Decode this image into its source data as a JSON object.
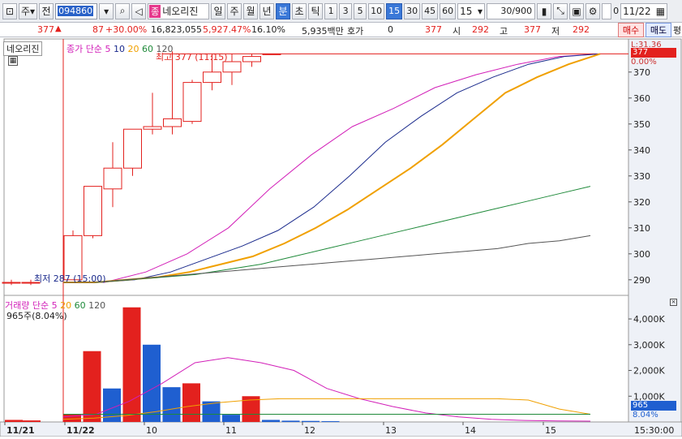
{
  "toolbar": {
    "market_label": "주",
    "all_label": "전",
    "stock_code": "094860",
    "stock_type_tag": "종",
    "stock_name": "네오리진",
    "periods": [
      "일",
      "주",
      "월",
      "년",
      "분",
      "초",
      "틱"
    ],
    "active_period": "분",
    "intervals": [
      "1",
      "3",
      "5",
      "10",
      "15",
      "30",
      "45",
      "60"
    ],
    "active_interval": "15",
    "interval_select": "15",
    "count": "30/900",
    "check_label": "0",
    "date": "11/22"
  },
  "quote": {
    "price": "377",
    "change": "87",
    "change_pct": "+30.00%",
    "volume": "16,823,055",
    "volume_pct": "5,927.47%",
    "turnover_pct": "16.10%",
    "amount": "5,935백만",
    "hoga_label": "호가",
    "hoga_value": "0",
    "hoga_price": "377",
    "open_label": "시",
    "open": "292",
    "high_label": "고",
    "high": "377",
    "low_label": "저",
    "low": "292",
    "buy_label": "매수",
    "sell_label": "매도",
    "avg_label": "평"
  },
  "price_panel": {
    "name_box": "네오리진",
    "ma_title": "종가 단순",
    "ma_periods": [
      "5",
      "10",
      "20",
      "60",
      "120"
    ],
    "high_marker": "최고 377 (11:15)",
    "low_marker": "최저 287 (15:00)",
    "corner_info": "L:31.36",
    "current_price_tag": "377",
    "pct_tag": "0.00%"
  },
  "volume_panel": {
    "title": "거래량 단순",
    "ma_periods": [
      "5",
      "20",
      "60",
      "120"
    ],
    "current": "965주(8.04%)",
    "current_tag": "965",
    "pct_tag": "8.04%"
  },
  "colors": {
    "up": "#e3211e",
    "down": "#1f5fd0",
    "ma5": "#d21fb8",
    "ma10": "#1a2a8c",
    "ma20": "#f0a000",
    "ma60": "#1f8a3a",
    "ma120": "#555555"
  },
  "chart_data": [
    {
      "type": "candlestick",
      "title": "네오리진 15분",
      "y_ticks": [
        290,
        300,
        310,
        320,
        330,
        340,
        350,
        360,
        370
      ],
      "ylim": [
        284,
        379
      ],
      "x_ticks": [
        "11/21",
        "11/22",
        "10",
        "11",
        "12",
        "13",
        "14",
        "15"
      ],
      "candles": [
        {
          "o": 289,
          "h": 290,
          "l": 288,
          "c": 289
        },
        {
          "o": 289,
          "h": 290,
          "l": 288,
          "c": 289
        },
        {
          "o": 290,
          "h": 309,
          "l": 290,
          "c": 307
        },
        {
          "o": 307,
          "h": 314,
          "l": 306,
          "c": 326
        },
        {
          "o": 325,
          "h": 343,
          "l": 318,
          "c": 333
        },
        {
          "o": 333,
          "h": 340,
          "l": 330,
          "c": 348
        },
        {
          "o": 348,
          "h": 362,
          "l": 346,
          "c": 349
        },
        {
          "o": 349,
          "h": 378,
          "l": 346,
          "c": 352
        },
        {
          "o": 351,
          "h": 367,
          "l": 350,
          "c": 366
        },
        {
          "o": 366,
          "h": 377,
          "l": 363,
          "c": 370
        },
        {
          "o": 370,
          "h": 377,
          "l": 365,
          "c": 374
        },
        {
          "o": 374,
          "h": 377,
          "l": 372,
          "c": 376
        },
        {
          "o": 377,
          "h": 377,
          "l": 377,
          "c": 377
        }
      ],
      "series": [
        {
          "name": "5",
          "values": [
            289,
            289,
            293,
            300,
            310,
            325,
            338,
            349,
            356,
            364,
            369,
            373,
            376,
            377
          ]
        },
        {
          "name": "10",
          "values": [
            289,
            289,
            290,
            293,
            298,
            303,
            309,
            318,
            330,
            343,
            353,
            362,
            368,
            373,
            376,
            377
          ]
        },
        {
          "name": "20",
          "values": [
            289,
            289,
            290,
            291,
            293,
            296,
            299,
            304,
            310,
            317,
            325,
            333,
            342,
            352,
            362,
            368,
            373,
            377
          ]
        },
        {
          "name": "60",
          "values": [
            289,
            289,
            290,
            291,
            292,
            294,
            296,
            299,
            302,
            305,
            308,
            311,
            314,
            317,
            320,
            323,
            326
          ]
        },
        {
          "name": "120",
          "values": [
            289,
            289,
            290,
            291,
            292,
            293,
            294,
            295,
            296,
            297,
            298,
            299,
            300,
            301,
            302,
            304,
            305,
            307
          ]
        }
      ]
    },
    {
      "type": "bar",
      "title": "거래량",
      "y_ticks": [
        "1,000K",
        "2,000K",
        "3,000K",
        "4,000K"
      ],
      "ylim": [
        0,
        4600
      ],
      "values": [
        80,
        60,
        300,
        2750,
        1300,
        4450,
        3000,
        1350,
        1500,
        800,
        280,
        1000,
        80,
        50,
        40,
        30
      ],
      "directions": [
        "up",
        "up",
        "up",
        "up",
        "down",
        "up",
        "down",
        "down",
        "up",
        "down",
        "down",
        "up",
        "down",
        "down",
        "down",
        "down"
      ],
      "series": [
        {
          "name": "5",
          "values": [
            200,
            300,
            800,
            1500,
            2300,
            2500,
            2300,
            2000,
            1300,
            900,
            600,
            350,
            200,
            100,
            60,
            40,
            30
          ]
        },
        {
          "name": "20",
          "values": [
            100,
            150,
            250,
            400,
            600,
            750,
            850,
            900,
            900,
            900,
            900,
            900,
            900,
            900,
            900,
            850,
            500,
            300
          ]
        },
        {
          "name": "60",
          "values": [
            300,
            300,
            300,
            300,
            300,
            300,
            300,
            300,
            300,
            300,
            300,
            300,
            300,
            300,
            300,
            300,
            300,
            300
          ]
        }
      ]
    }
  ]
}
